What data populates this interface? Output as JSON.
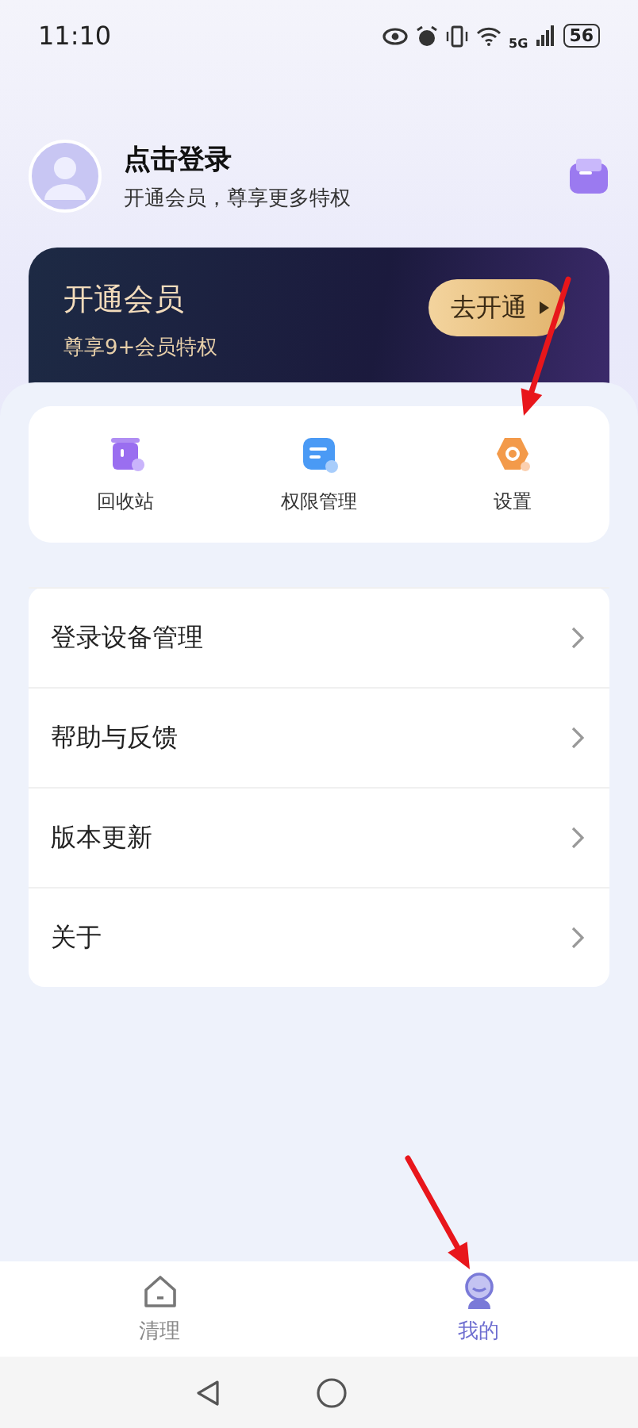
{
  "status_bar": {
    "time": "11:10",
    "network": "5G",
    "battery": "56"
  },
  "profile": {
    "title": "点击登录",
    "subtitle": "开通会员，尊享更多特权"
  },
  "vip_banner": {
    "title": "开通会员",
    "subtitle": "尊享9+会员特权",
    "button": "去开通"
  },
  "quick_actions": [
    {
      "kind": "trash",
      "label": "回收站"
    },
    {
      "kind": "permission",
      "label": "权限管理"
    },
    {
      "kind": "settings",
      "label": "设置"
    }
  ],
  "menu": [
    {
      "label": "登录设备管理"
    },
    {
      "label": "帮助与反馈"
    },
    {
      "label": "版本更新"
    },
    {
      "label": "关于"
    }
  ],
  "bottom_nav": [
    {
      "kind": "home",
      "label": "清理",
      "selected": false
    },
    {
      "kind": "me",
      "label": "我的",
      "selected": true
    }
  ]
}
